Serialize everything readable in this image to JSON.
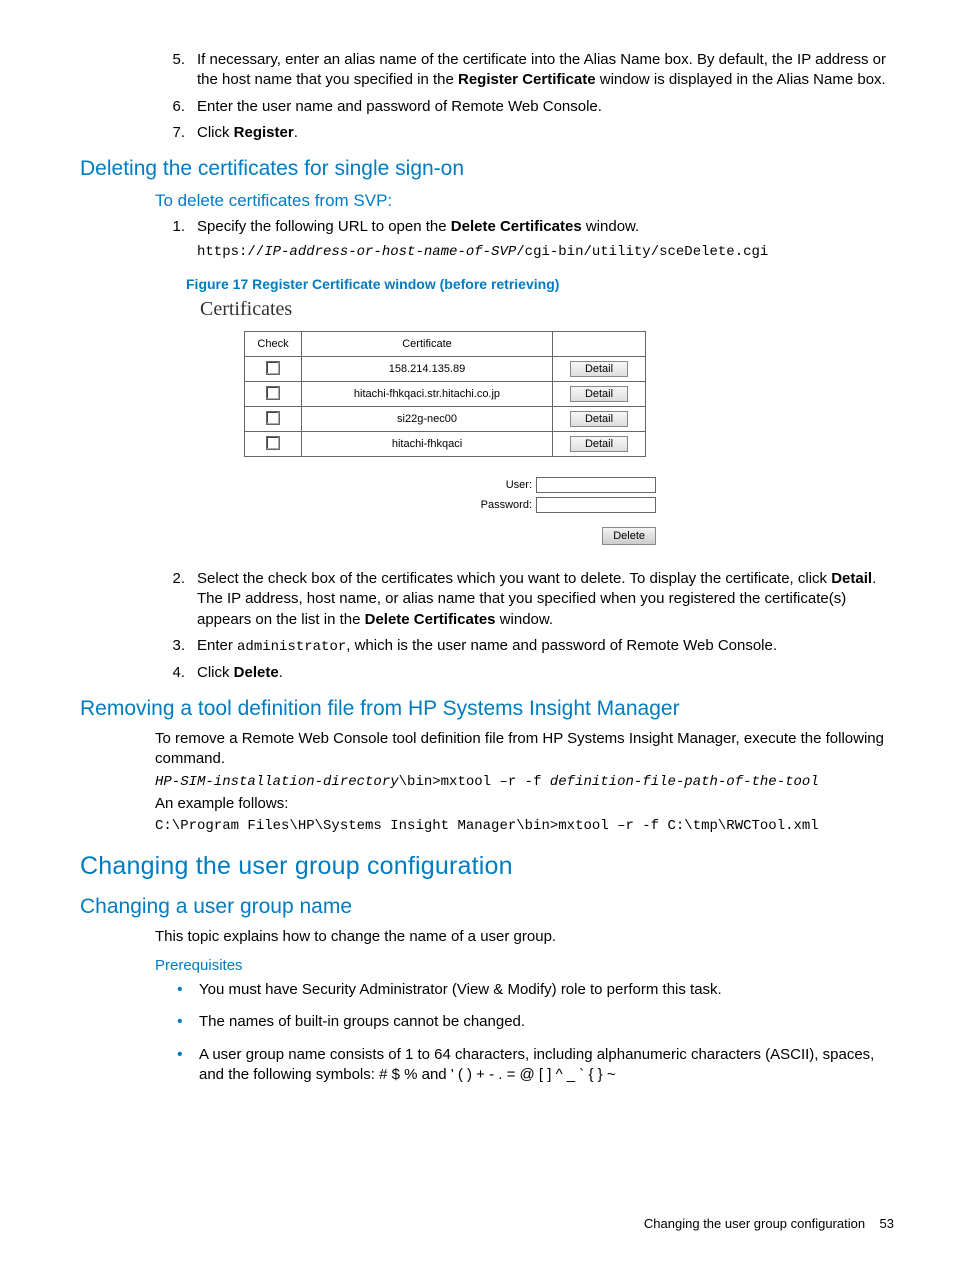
{
  "top_list": {
    "items": [
      {
        "num": "5.",
        "pre": "If necessary, enter an alias name of the certificate into the Alias Name box. By default, the IP address or the host name that you specified in the ",
        "bold": "Register Certificate",
        "post": " window is displayed in the Alias Name box."
      },
      {
        "num": "6.",
        "pre": "Enter the user name and password of Remote Web Console.",
        "bold": "",
        "post": ""
      },
      {
        "num": "7.",
        "pre": "Click ",
        "bold": "Register",
        "post": "."
      }
    ]
  },
  "delete_section": {
    "heading": "Deleting the certificates for single sign-on",
    "subheading": "To delete certificates from SVP:",
    "step1": {
      "num": "1.",
      "pre": "Specify the following URL to open the ",
      "bold": "Delete Certificates",
      "post": " window."
    },
    "url_pre": "https://",
    "url_var": "IP-address-or-host-name-of-SVP",
    "url_post": "/cgi-bin/utility/sceDelete.cgi",
    "fig_caption": "Figure 17 Register Certificate window (before retrieving)",
    "cert_title": "Certificates",
    "table": {
      "headers": {
        "check": "Check",
        "cert": "Certificate",
        "detail": ""
      },
      "rows": [
        {
          "cert": "158.214.135.89",
          "btn": "Detail"
        },
        {
          "cert": "hitachi-fhkqaci.str.hitachi.co.jp",
          "btn": "Detail"
        },
        {
          "cert": "si22g-nec00",
          "btn": "Detail"
        },
        {
          "cert": "hitachi-fhkqaci",
          "btn": "Detail"
        }
      ]
    },
    "form": {
      "user_label": "User:",
      "pass_label": "Password:",
      "delete_btn": "Delete"
    },
    "steps_after": [
      {
        "num": "2.",
        "parts": [
          {
            "t": "Select the check box of the certificates which you want to delete. To display the certificate, click "
          },
          {
            "b": "Detail"
          },
          {
            "t": ". The IP address, host name, or alias name that you specified when you registered the certificate(s) appears on the list in the "
          },
          {
            "b": "Delete Certificates"
          },
          {
            "t": " window."
          }
        ]
      },
      {
        "num": "3.",
        "parts": [
          {
            "t": "Enter "
          },
          {
            "m": "administrator"
          },
          {
            "t": ", which is the user name and password of Remote Web Console."
          }
        ]
      },
      {
        "num": "4.",
        "parts": [
          {
            "t": "Click "
          },
          {
            "b": "Delete"
          },
          {
            "t": "."
          }
        ]
      }
    ]
  },
  "remove_section": {
    "heading": "Removing a tool definition file from HP Systems Insight Manager",
    "intro": "To remove a Remote Web Console tool definition file from HP Systems Insight Manager, execute the following command.",
    "cmd_var1": "HP-SIM-installation-directory",
    "cmd_mid": "\\bin>mxtool –r -f ",
    "cmd_var2": "definition-file-path-of-the-tool",
    "example_label": "An example follows:",
    "example_cmd": "C:\\Program Files\\HP\\Systems Insight Manager\\bin>mxtool –r -f C:\\tmp\\RWCTool.xml"
  },
  "change_section": {
    "h2": "Changing the user group configuration",
    "h3": "Changing a user group name",
    "intro": "This topic explains how to change the name of a user group.",
    "prereq_heading": "Prerequisites",
    "bullets": [
      "You must have Security Administrator (View & Modify) role to perform this task.",
      "The names of built-in groups cannot be changed.",
      "A user group name consists of 1 to 64 characters, including alphanumeric characters (ASCII), spaces, and the following symbols: # $ % and ' ( ) + - . = @ [ ] ^ _ ` { } ~"
    ]
  },
  "footer": {
    "text": "Changing the user group configuration",
    "page": "53"
  }
}
